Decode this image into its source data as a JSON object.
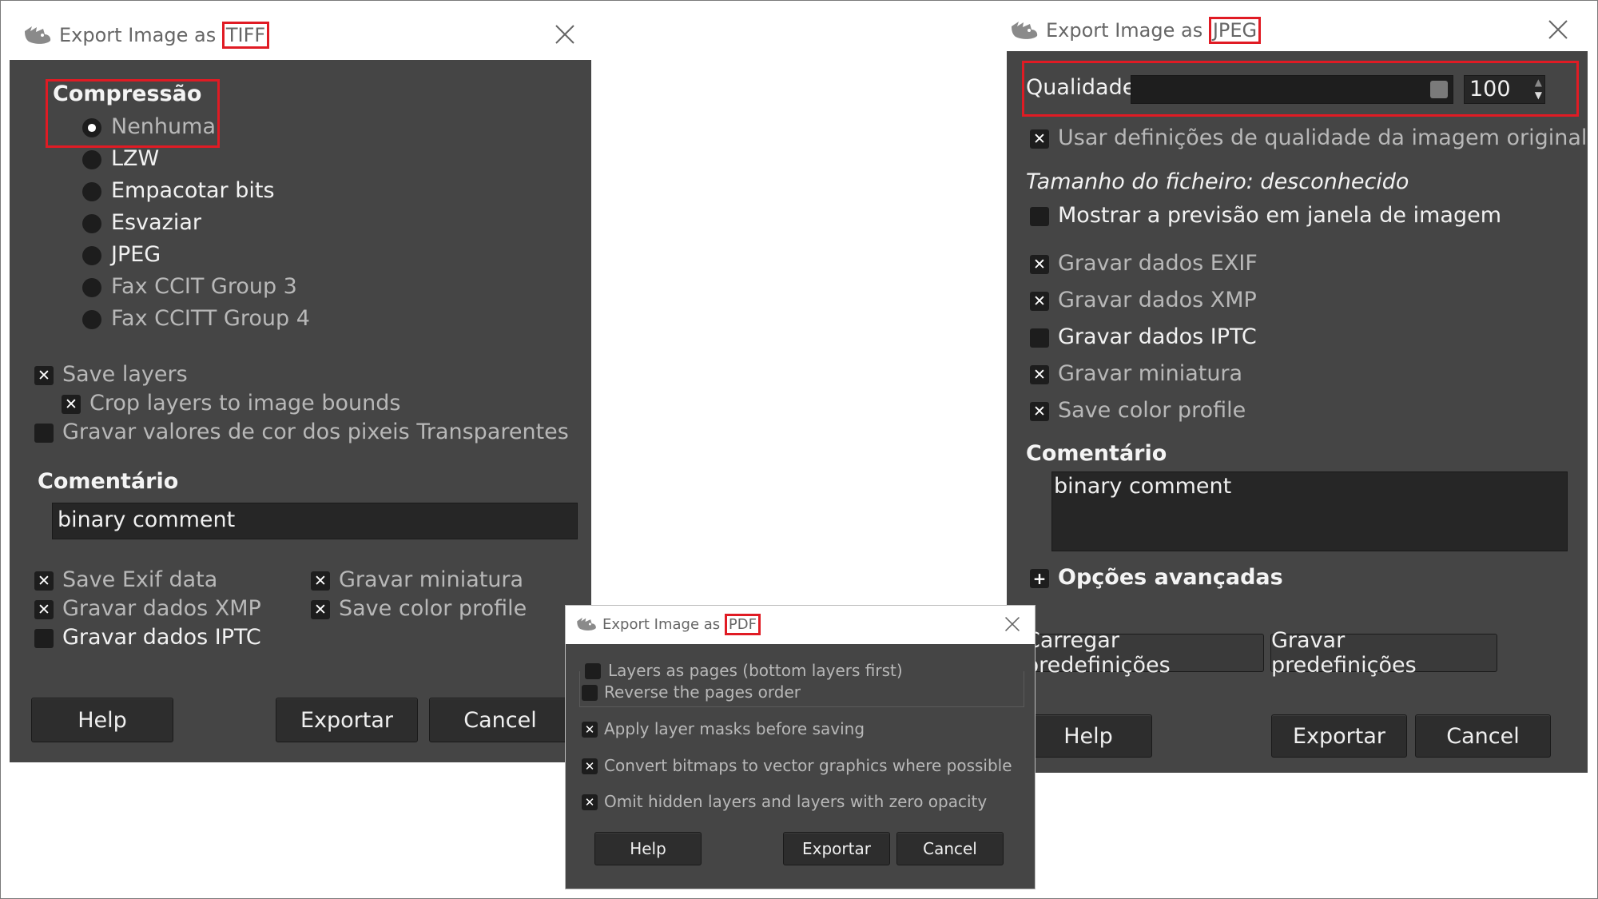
{
  "tiff": {
    "title_prefix": "Export Image as ",
    "title_format": "TIFF",
    "compression_label": "Compressão",
    "compression_options": [
      "Nenhuma",
      "LZW",
      "Empacotar bits",
      "Esvaziar",
      "JPEG",
      "Fax CCIT Group 3",
      "Fax CCITT Group 4"
    ],
    "compression_selected": "Nenhuma",
    "save_layers": "Save layers",
    "crop_layers": "Crop layers to image bounds",
    "save_transparent": "Gravar valores de cor dos pixeis Transparentes",
    "comment_label": "Comentário",
    "comment_value": "binary comment",
    "save_exif": "Save Exif data",
    "save_xmp": "Gravar dados XMP",
    "save_iptc": "Gravar dados IPTC",
    "save_thumbnail": "Gravar miniatura",
    "save_color_profile": "Save color profile",
    "help_button": "Help",
    "export_button": "Exportar",
    "cancel_button": "Cancel"
  },
  "jpeg": {
    "title_prefix": "Export Image as ",
    "title_format": "JPEG",
    "quality_label": "Qualidade:",
    "quality_value": "100",
    "use_original_quality": "Usar definições de qualidade da imagem original",
    "file_size": "Tamanho do ficheiro: desconhecido",
    "show_preview": "Mostrar a previsão em janela de imagem",
    "save_exif": "Gravar dados EXIF",
    "save_xmp": "Gravar dados XMP",
    "save_iptc": "Gravar dados IPTC",
    "save_thumbnail": "Gravar miniatura",
    "save_color_profile": "Save color profile",
    "comment_label": "Comentário",
    "comment_value": "binary comment",
    "advanced_options": "Opções avançadas",
    "load_defaults": "Carregar predefinições",
    "save_defaults": "Gravar predefinições",
    "help_button": "Help",
    "export_button": "Exportar",
    "cancel_button": "Cancel"
  },
  "pdf": {
    "title_prefix": "Export Image as ",
    "title_format": "PDF",
    "layers_as_pages": "Layers as pages (bottom layers first)",
    "reverse_order": "Reverse the pages order",
    "apply_masks": "Apply layer masks before saving",
    "convert_bitmaps": "Convert bitmaps to vector graphics where possible",
    "omit_hidden": "Omit hidden layers and layers with zero opacity",
    "help_button": "Help",
    "export_button": "Exportar",
    "cancel_button": "Cancel"
  },
  "colors": {
    "dialog_background": "#454545",
    "button_background": "#2d2d2d",
    "highlight": "#e01b24"
  },
  "icons": [
    "gimp-wilber-icon",
    "close-icon",
    "checkbox-checked-icon",
    "expander-plus-icon"
  ]
}
